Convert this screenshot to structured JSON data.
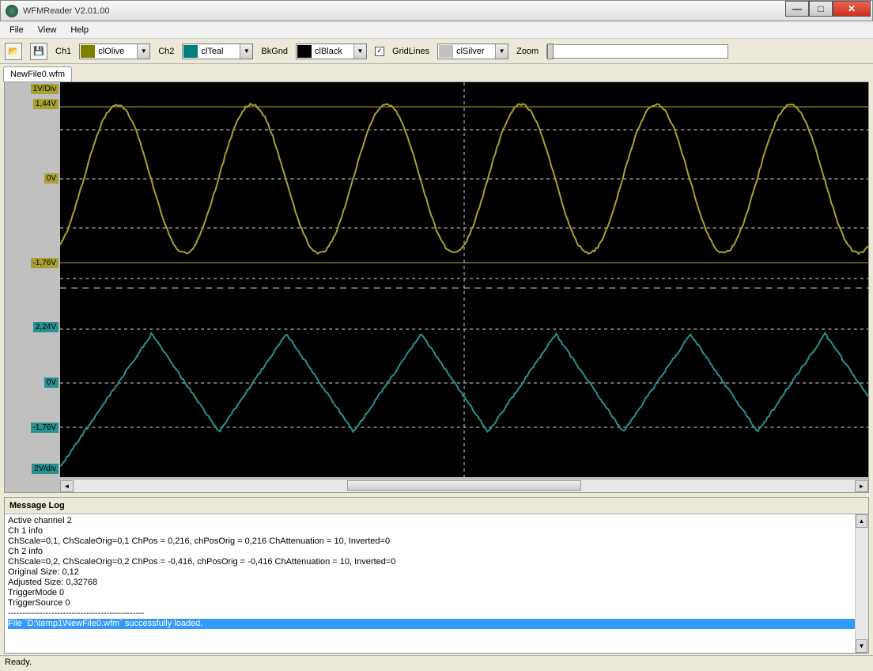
{
  "window": {
    "title": "WFMReader V2.01.00"
  },
  "menu": {
    "file": "File",
    "view": "View",
    "help": "Help"
  },
  "toolbar": {
    "ch1_label": "Ch1",
    "ch1_color": "clOlive",
    "ch1_hex": "#808000",
    "ch2_label": "Ch2",
    "ch2_color": "clTeal",
    "ch2_hex": "#008080",
    "bkgnd_label": "BkGnd",
    "bkgnd_color": "clBlack",
    "bkgnd_hex": "#000000",
    "gridlines_label": "GridLines",
    "gridlines_checked": "✓",
    "grid_color": "clSilver",
    "grid_hex": "#c0c0c0",
    "zoom_label": "Zoom"
  },
  "tabs": {
    "file_tab": "NewFile0.wfm"
  },
  "axis": {
    "ch1_scale": "1V/Div",
    "ch1_max": "1,44V",
    "ch1_zero": "0V",
    "ch1_min": "-1,76V",
    "ch2_max": "2,24V",
    "ch2_zero": "0V",
    "ch2_min": "-1,76V",
    "ch2_scale": "2V/div"
  },
  "chart_data": {
    "type": "line",
    "background": "#000000",
    "grid_on": true,
    "series": [
      {
        "name": "Ch1",
        "color": "#a8a030",
        "waveform": "sine",
        "amplitude_v": 1.6,
        "offset_v": -0.16,
        "periods_visible": 6,
        "label_max": "1,44V",
        "label_zero": "0V",
        "label_min": "-1,76V",
        "scale": "1V/Div"
      },
      {
        "name": "Ch2",
        "color": "#2a9090",
        "waveform": "triangle",
        "amplitude_v": 2.0,
        "offset_v": 0.24,
        "periods_visible": 6,
        "label_max": "2,24V",
        "label_zero": "0V",
        "label_min": "-1,76V",
        "scale": "2V/div"
      }
    ]
  },
  "log": {
    "title": "Message Log",
    "lines": [
      "Active channel 2",
      "Ch 1 info",
      "ChScale=0,1, ChScaleOrig=0,1 ChPos = 0,216, chPosOrig = 0,216 ChAttenuation = 10, Inverted=0",
      "Ch 2 info",
      "ChScale=0,2, ChScaleOrig=0,2 ChPos = -0,416, chPosOrig = -0,416 ChAttenuation = 10, Inverted=0",
      "Original Size: 0,12",
      "Adjusted Size: 0,32768",
      "TriggerMode 0",
      "TriggerSource 0",
      "-----------------------------------------------",
      "File `D:\\temp1\\NewFile0.wfm` successfully loaded."
    ]
  },
  "status": {
    "text": "Ready."
  }
}
